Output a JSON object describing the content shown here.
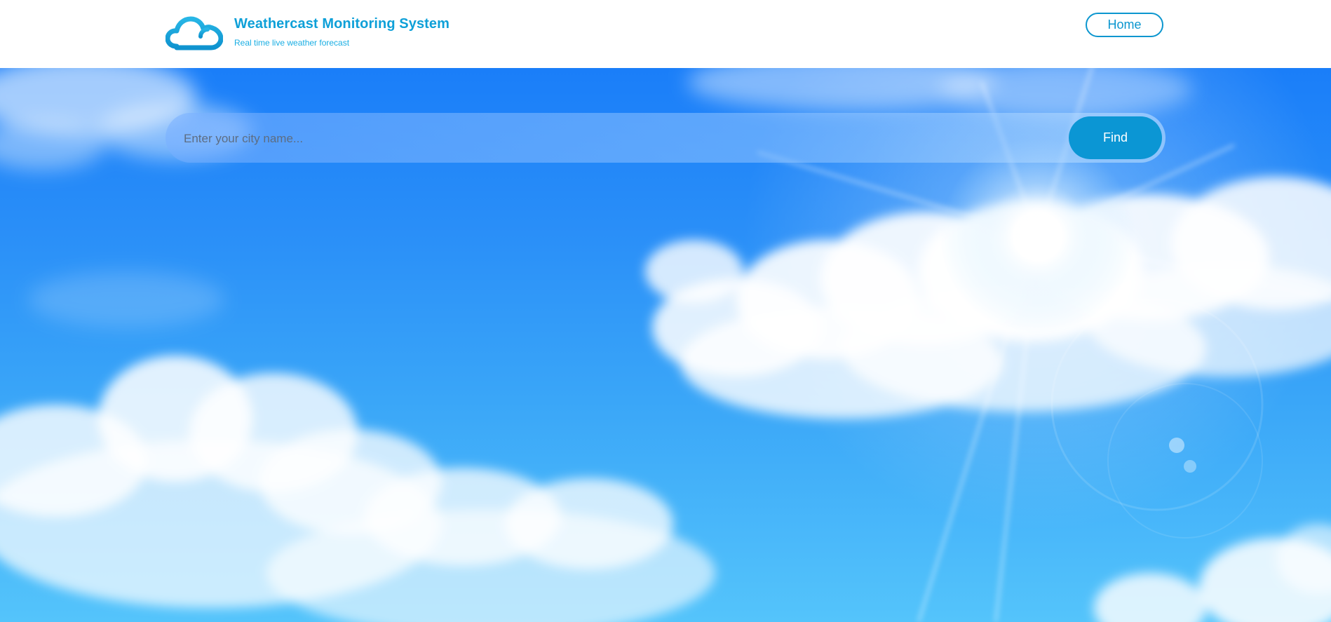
{
  "header": {
    "logo_icon": "cloud-icon",
    "title": "Weathercast Monitoring System",
    "subtitle": "Real time live weather forecast",
    "home_label": "Home"
  },
  "search": {
    "placeholder": "Enter your city name...",
    "value": "",
    "button_label": "Find"
  },
  "hero": {
    "background": "sunny-sky-with-clouds"
  },
  "colors": {
    "brand": "#0ea0d8",
    "button": "#0b96d4",
    "sky_top": "#1a7ef9",
    "sky_bottom": "#54c4fb"
  }
}
